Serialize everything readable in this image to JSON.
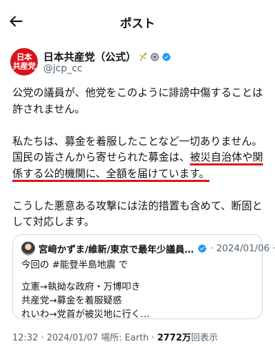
{
  "header": {
    "title": "ポスト",
    "back_icon": "arrow-left-icon"
  },
  "author": {
    "avatar_text_1": "日本",
    "avatar_text_2": "共産党",
    "name": "日本共産党（公式）",
    "handle": "@jcp_cc",
    "badges": [
      "rice-icon",
      "gear-emblem-icon",
      "verified-badge-icon"
    ],
    "avatar_color": "#d7141a"
  },
  "tweet": {
    "line1": "公党の議員が、他党をこのように誹謗中傷することは許されません。",
    "line2": "私たちは、募金を着服したことなど一切ありません。",
    "line3_plain": "国民の皆さんから寄せられた募金は、",
    "line3_underlined": "被災自治体や関係する公的機関に、全額を届けています。",
    "line4": "こうした悪意ある攻撃には法的措置も含めて、断固として対応します。"
  },
  "quote": {
    "name": "宮﨑かずま/維新/東京で最年少議員…",
    "date": "· 2024/01/06 ·",
    "line1": "今回の #能登半島地震 で",
    "line2": "立憲→執拗な政府・万博叩き",
    "line3": "共産党→募金を着服疑惑",
    "line4": "れいわ→党首が被災地に行く…"
  },
  "meta": {
    "prefix": "12:32 · 2024/01/07 場所: Earth · ",
    "views_count": "2772万",
    "views_suffix": "回表示"
  },
  "colors": {
    "accent": "#1d9bf0",
    "underline": "#e0101a",
    "muted": "#536471"
  }
}
